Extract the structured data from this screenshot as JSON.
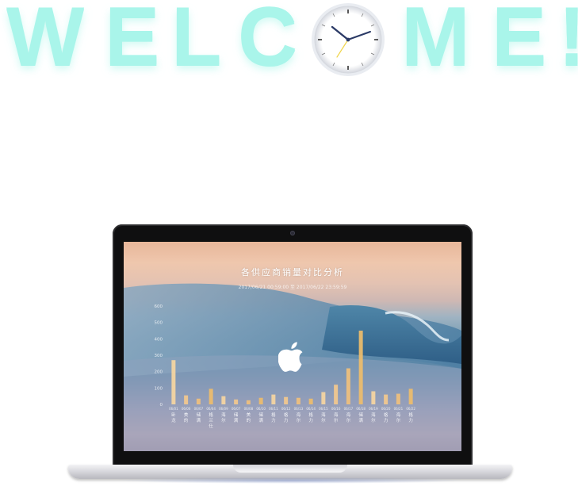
{
  "welcome": {
    "letters": [
      "W",
      "E",
      "L",
      "C",
      "M",
      "E",
      "!"
    ],
    "color": "#a9f5ea"
  },
  "clock": {
    "icon": "analog-clock-icon",
    "hour_hand_color": "#2b3a66",
    "minute_hand_color": "#2b3a66",
    "second_hand_color": "#f0d54a"
  },
  "screen": {
    "title": "各供应商销量对比分析",
    "subtitle": "2017/06/21 00:59:00 至 2017/06/22 23:59:59",
    "logo": "apple-logo-icon"
  },
  "chart_data": {
    "type": "bar",
    "y_ticks": [
      "0",
      "100",
      "200",
      "300",
      "400",
      "500",
      "600"
    ],
    "ylim": [
      0,
      600
    ],
    "categories": [
      "06/01",
      "06/06",
      "06/07",
      "06/04",
      "06/09",
      "06/07",
      "06/08",
      "06/10",
      "06/11",
      "06/12",
      "06/13",
      "06/14",
      "06/15",
      "06/16",
      "06/17",
      "06/18",
      "06/19",
      "06/20",
      "06/21",
      "06/22"
    ],
    "x_labels": [
      "卧龙",
      "美的",
      "储满",
      "格兰仕",
      "海尔",
      "储满",
      "美的",
      "储满",
      "格力",
      "格力",
      "海尔",
      "格力",
      "海尔",
      "海尔",
      "海尔",
      "储满",
      "海尔",
      "格力",
      "海尔",
      "格力"
    ],
    "values": [
      270,
      55,
      35,
      95,
      50,
      30,
      25,
      40,
      60,
      45,
      40,
      35,
      75,
      120,
      220,
      450,
      80,
      60,
      65,
      95
    ],
    "bar_colors": [
      "#f6d6a1",
      "#f3c98d",
      "#f0c07c",
      "#eebd6b"
    ]
  }
}
